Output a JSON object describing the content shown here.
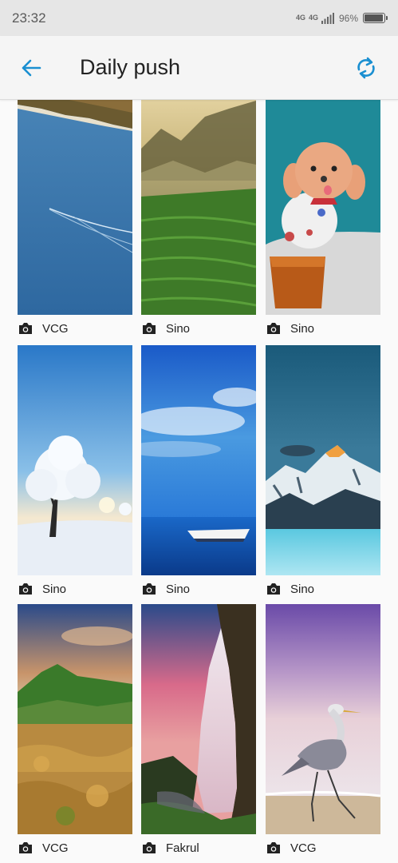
{
  "status_bar": {
    "time": "23:32",
    "network_1": "4G",
    "network_2": "4G",
    "battery_percent": "96%",
    "battery_level": 0.96
  },
  "app_bar": {
    "title": "Daily push",
    "back_icon": "arrow-left-icon",
    "refresh_icon": "refresh-icon",
    "accent_color": "#1a8fd1"
  },
  "wallpapers": [
    {
      "source": "VCG",
      "subject": "lake-shore"
    },
    {
      "source": "Sino",
      "subject": "mountain-terraces"
    },
    {
      "source": "Sino",
      "subject": "poodle"
    },
    {
      "source": "Sino",
      "subject": "snowy-tree"
    },
    {
      "source": "Sino",
      "subject": "sea-boat"
    },
    {
      "source": "Sino",
      "subject": "snow-mountains"
    },
    {
      "source": "VCG",
      "subject": "green-hills"
    },
    {
      "source": "Fakrul",
      "subject": "waterfall"
    },
    {
      "source": "VCG",
      "subject": "heron"
    }
  ]
}
